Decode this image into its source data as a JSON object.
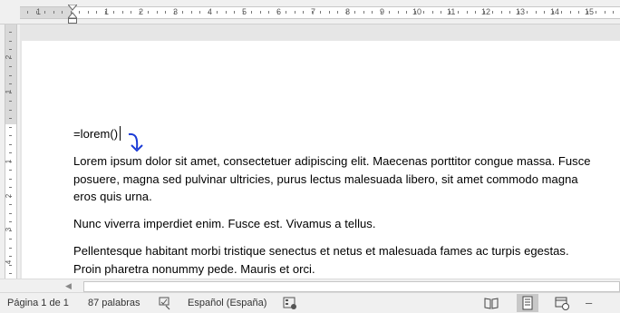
{
  "ruler": {
    "horizontal_ticks": [
      "1",
      "1",
      "2",
      "3",
      "4",
      "5",
      "6",
      "7",
      "8",
      "9",
      "10",
      "11",
      "12",
      "13",
      "14",
      "15"
    ],
    "vertical_ticks": [
      "2",
      "1",
      "1",
      "2",
      "3",
      "4"
    ]
  },
  "document": {
    "lines": [
      "=lorem()",
      "Lorem ipsum dolor sit amet, consectetuer adipiscing elit. Maecenas porttitor congue massa. Fusce",
      "posuere, magna sed pulvinar ultricies, purus lectus malesuada libero, sit amet commodo magna",
      "eros quis urna.",
      "Nunc viverra imperdiet enim. Fusce est. Vivamus a tellus.",
      "Pellentesque habitant morbi tristique senectus et netus et malesuada fames ac turpis egestas.",
      "Proin pharetra nonummy pede. Mauris et orci."
    ],
    "annotation_color": "#1a3ad6"
  },
  "status_bar": {
    "page": "Página 1 de 1",
    "words": "87 palabras",
    "language": "Español (España)"
  },
  "icons": [
    "proofing-icon",
    "macro-icon",
    "read-mode-icon",
    "print-layout-icon",
    "web-layout-icon"
  ]
}
